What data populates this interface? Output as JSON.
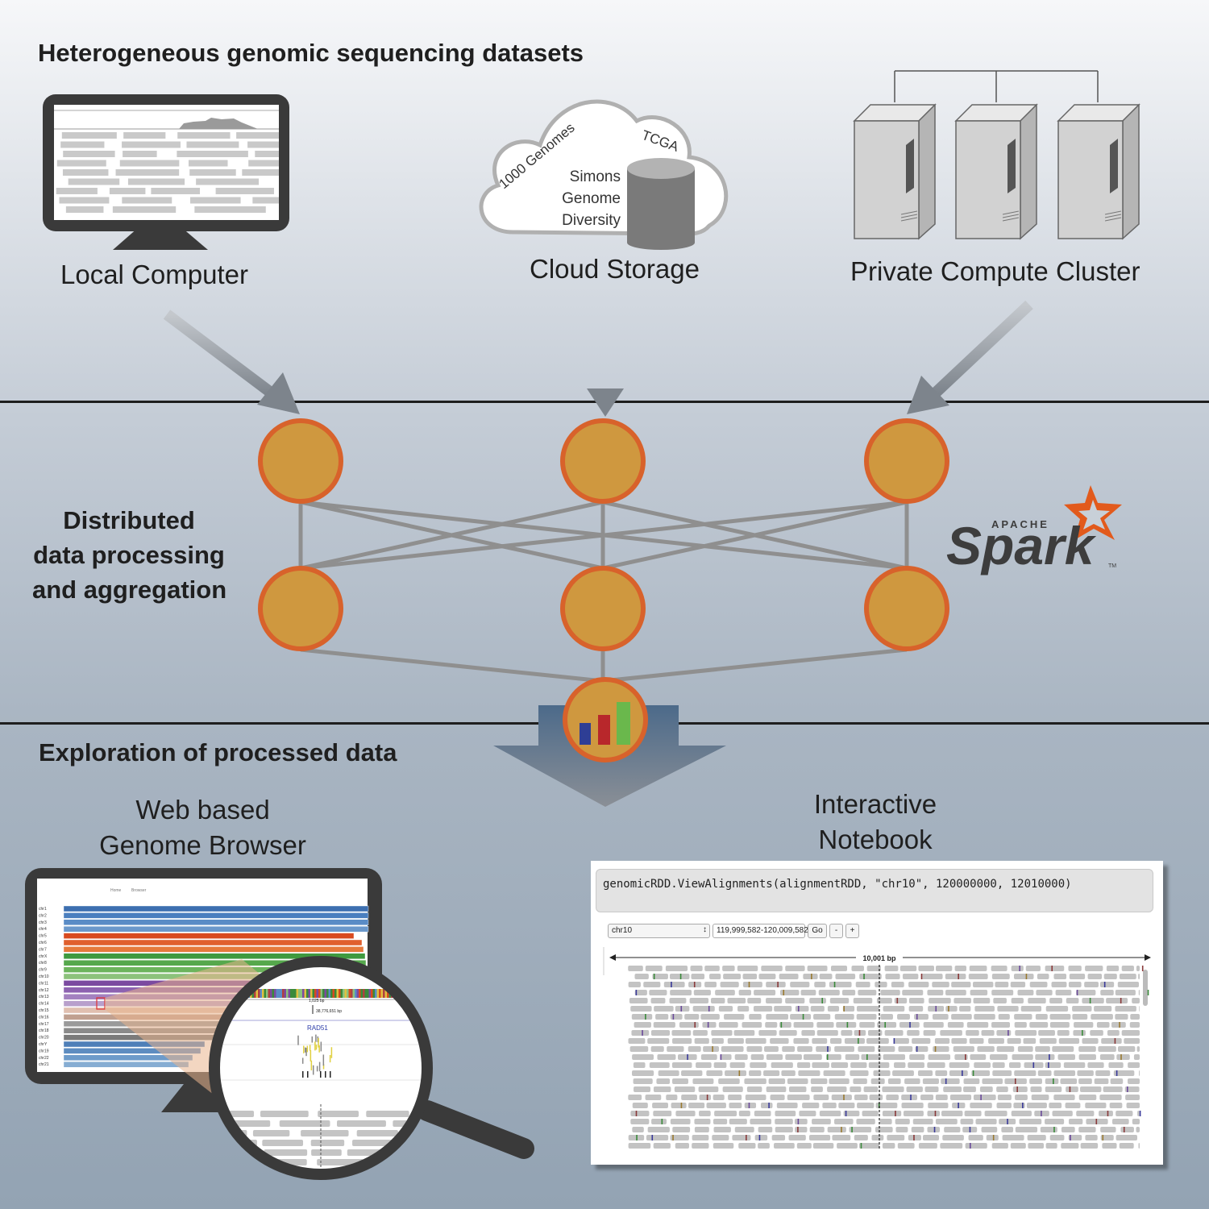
{
  "sections": {
    "datasets_title": "Heterogeneous genomic sequencing datasets",
    "processing_title_line1": "Distributed",
    "processing_title_line2": "data processing",
    "processing_title_line3": "and aggregation",
    "exploration_title": "Exploration of processed data"
  },
  "sources": {
    "local": "Local Computer",
    "cloud": "Cloud Storage",
    "cluster": "Private Compute Cluster",
    "cloud_datasets": {
      "genomes": "1000 Genomes",
      "tcga": "TCGA",
      "simons_1": "Simons",
      "simons_2": "Genome",
      "simons_3": "Diversity"
    }
  },
  "spark_logo": {
    "top": "APACHE",
    "word": "Spark",
    "tm": "TM"
  },
  "browser": {
    "title_line1": "Web based",
    "title_line2": "Genome Browser",
    "nav_home": "Home",
    "nav_browser": "Browser",
    "chromosomes": [
      "chr1",
      "chr2",
      "chr3",
      "chr4",
      "chr5",
      "chr6",
      "chr7",
      "chrX",
      "chr8",
      "chr9",
      "chr10",
      "chr11",
      "chr12",
      "chr13",
      "chr14",
      "chr15",
      "chr16",
      "chr17",
      "chr18",
      "chr20",
      "chrY",
      "chr19",
      "chr22",
      "chr21"
    ],
    "zoom_scale": "1,025 bp",
    "zoom_position": "38,776,651 bp",
    "gene": "RAD51"
  },
  "notebook": {
    "title_line1": "Interactive",
    "title_line2": "Notebook",
    "code": "genomicRDD.ViewAlignments(alignmentRDD, \"chr10\", 120000000, 12010000)",
    "chrom_select": "chr10",
    "range_input": "119,999,582-120,009,582",
    "go_button": "Go",
    "minus_button": "-",
    "plus_button": "+",
    "scale_label": "10,001 bp"
  },
  "colors": {
    "node_fill": "#cf983f",
    "node_stroke": "#d8622b",
    "arrow": "#9aa2ab",
    "spark_orange": "#e25a1c",
    "spark_dark": "#3d3d3d"
  }
}
